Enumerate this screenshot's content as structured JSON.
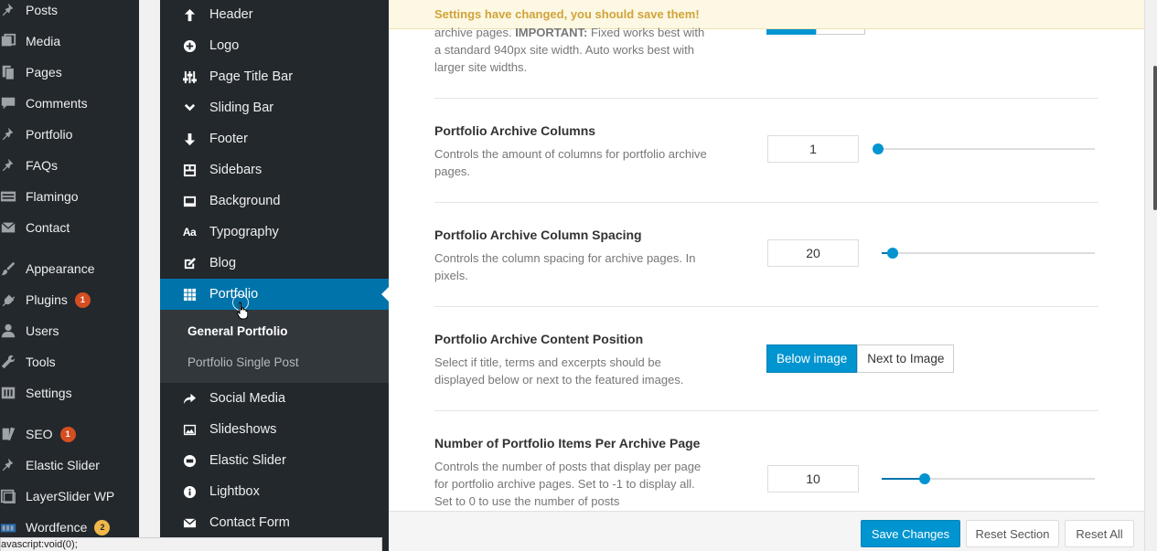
{
  "wp_menu": [
    {
      "label": "Posts",
      "icon": "pin-icon"
    },
    {
      "label": "Media",
      "icon": "media-icon"
    },
    {
      "label": "Pages",
      "icon": "pages-icon"
    },
    {
      "label": "Comments",
      "icon": "comments-icon"
    },
    {
      "label": "Portfolio",
      "icon": "pin-icon"
    },
    {
      "label": "FAQs",
      "icon": "pin-icon"
    },
    {
      "label": "Flamingo",
      "icon": "flamingo-icon"
    },
    {
      "label": "Contact",
      "icon": "mail-icon"
    },
    {
      "label": "Appearance",
      "icon": "brush-icon"
    },
    {
      "label": "Plugins",
      "icon": "plug-icon",
      "badge": "1"
    },
    {
      "label": "Users",
      "icon": "user-icon"
    },
    {
      "label": "Tools",
      "icon": "wrench-icon"
    },
    {
      "label": "Settings",
      "icon": "settings-icon"
    },
    {
      "label": "SEO",
      "icon": "seo-icon",
      "badge": "1"
    },
    {
      "label": "Elastic Slider",
      "icon": "pin-icon"
    },
    {
      "label": "LayerSlider WP",
      "icon": "layers-icon"
    },
    {
      "label": "Wordfence",
      "icon": "wordfence-icon",
      "badge": "2"
    }
  ],
  "options_menu": [
    {
      "label": "Header",
      "icon": "arrow-up-icon"
    },
    {
      "label": "Logo",
      "icon": "plus-circle-icon"
    },
    {
      "label": "Page Title Bar",
      "icon": "sliders-icon"
    },
    {
      "label": "Sliding Bar",
      "icon": "chevron-down-icon"
    },
    {
      "label": "Footer",
      "icon": "arrow-down-icon"
    },
    {
      "label": "Sidebars",
      "icon": "sidebars-icon"
    },
    {
      "label": "Background",
      "icon": "background-icon"
    },
    {
      "label": "Typography",
      "icon": "typography-icon",
      "glyph": "Aa"
    },
    {
      "label": "Blog",
      "icon": "edit-icon"
    },
    {
      "label": "Portfolio",
      "icon": "grid-icon"
    },
    {
      "label": "Social Media",
      "icon": "share-icon"
    },
    {
      "label": "Slideshows",
      "icon": "image-icon"
    },
    {
      "label": "Elastic Slider",
      "icon": "elastic-slider-icon"
    },
    {
      "label": "Lightbox",
      "icon": "info-icon"
    },
    {
      "label": "Contact Form",
      "icon": "envelope-icon"
    }
  ],
  "options_submenu": [
    "General Portfolio",
    "Portfolio Single Post"
  ],
  "status_url": "avascript:void(0);",
  "notice": "Settings have changed, you should save them!",
  "top_desc": {
    "pre": "archive pages.",
    "strong": "IMPORTANT:",
    "post": "Fixed works best with a standard 940px site width. Auto works best with larger site widths."
  },
  "settings": {
    "columns": {
      "title": "Portfolio Archive Columns",
      "desc": "Controls the amount of columns for portfolio archive pages.",
      "value": "1",
      "slider_fraction": 0.0
    },
    "spacing": {
      "title": "Portfolio Archive Column Spacing",
      "desc": "Controls the column spacing for archive pages. In pixels.",
      "value": "20",
      "slider_fraction": 0.05
    },
    "position": {
      "title": "Portfolio Archive Content Position",
      "desc": "Select if title, terms and excerpts should be displayed below or next to the featured images.",
      "options": [
        "Below image",
        "Next to Image"
      ],
      "selected": "Below image"
    },
    "items": {
      "title": "Number of Portfolio Items Per Archive Page",
      "desc": "Controls the number of posts that display per page for portfolio archive pages. Set to -1 to display all. Set to 0 to use the number of posts",
      "value": "10",
      "slider_fraction": 0.2
    }
  },
  "footer": {
    "save": "Save Changes",
    "reset_section": "Reset Section",
    "reset_all": "Reset All"
  },
  "colors": {
    "accent": "#0094d1",
    "admin_bg": "#23282d",
    "notice_text": "#d1a33a",
    "badge": "#d54e21"
  }
}
